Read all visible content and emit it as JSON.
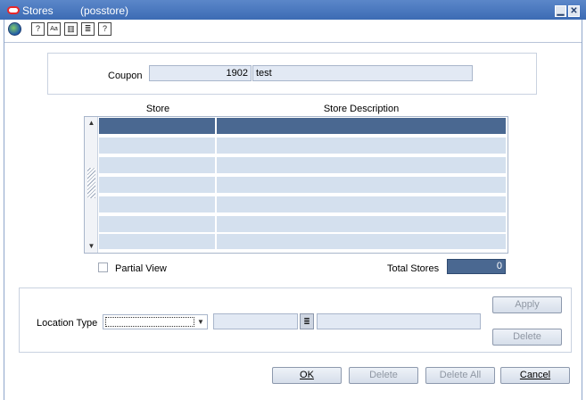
{
  "window": {
    "title": "Stores",
    "subtitle": "(posstore)",
    "minimize_glyph": "▁",
    "close_glyph": "✕"
  },
  "toolbar": {
    "icons": [
      "globe-icon",
      "help-context-icon",
      "spellcheck-icon",
      "edit-field-icon",
      "print-icon",
      "help-icon"
    ]
  },
  "coupon": {
    "label": "Coupon",
    "id": "1902",
    "description": "test"
  },
  "table": {
    "columns": [
      "Store",
      "Store Description"
    ],
    "rows": [
      [
        "",
        ""
      ],
      [
        "",
        ""
      ],
      [
        "",
        ""
      ],
      [
        "",
        ""
      ],
      [
        "",
        ""
      ],
      [
        "",
        ""
      ]
    ],
    "selected_row": 0
  },
  "partial_view": {
    "label": "Partial View",
    "checked": false
  },
  "total_stores": {
    "label": "Total Stores",
    "value": "0"
  },
  "location": {
    "label": "Location Type",
    "selected": "",
    "code": "",
    "description": "",
    "apply_label": "Apply",
    "delete_label": "Delete"
  },
  "footer": {
    "ok_label": "OK",
    "delete_label": "Delete",
    "delete_all_label": "Delete All",
    "cancel_label": "Cancel"
  },
  "colors": {
    "titlebar": "#3c6bb4",
    "selected_row": "#4a6891",
    "row": "#d4e0ee"
  }
}
